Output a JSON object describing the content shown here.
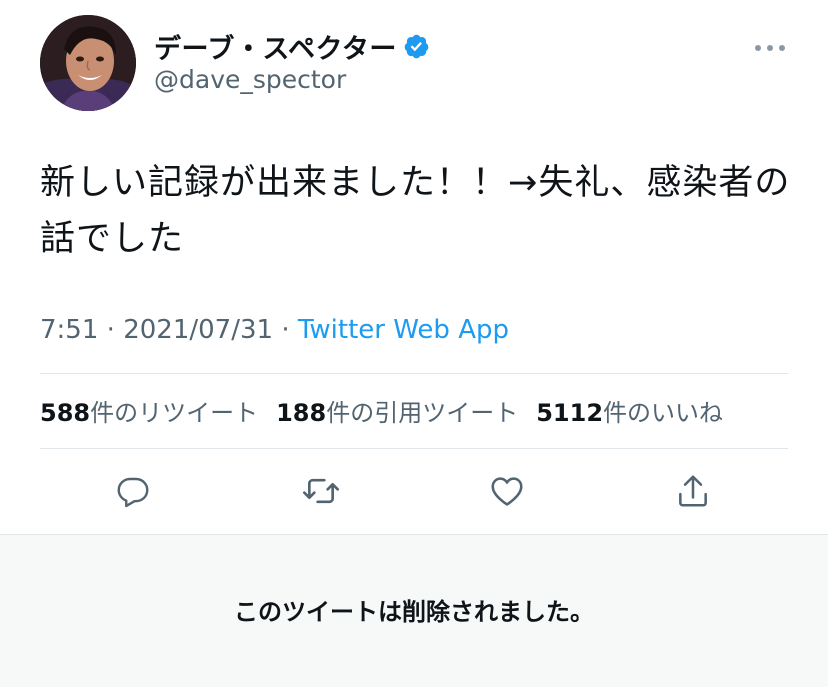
{
  "tweet": {
    "display_name": "デーブ・スペクター",
    "handle": "@dave_spector",
    "text": "新しい記録が出来ました！！→失礼、感染者の話でした",
    "time": "7:51",
    "separator": "·",
    "date": "2021/07/31",
    "source": "Twitter Web App"
  },
  "stats": {
    "retweets_count": "588",
    "retweets_label": "件のリツイート",
    "quotes_count": "188",
    "quotes_label": "件の引用ツイート",
    "likes_count": "5112",
    "likes_label": "件のいいね"
  },
  "deleted_notice": "このツイートは削除されました。",
  "icons": {
    "verified": "verified-badge-icon",
    "more": "more-options-icon",
    "reply": "reply-icon",
    "retweet": "retweet-icon",
    "like": "heart-icon",
    "share": "share-icon"
  },
  "colors": {
    "accent": "#1d9bf0",
    "secondary_text": "#536471",
    "primary_text": "#0f1419",
    "deleted_background": "#f7f9f9"
  }
}
